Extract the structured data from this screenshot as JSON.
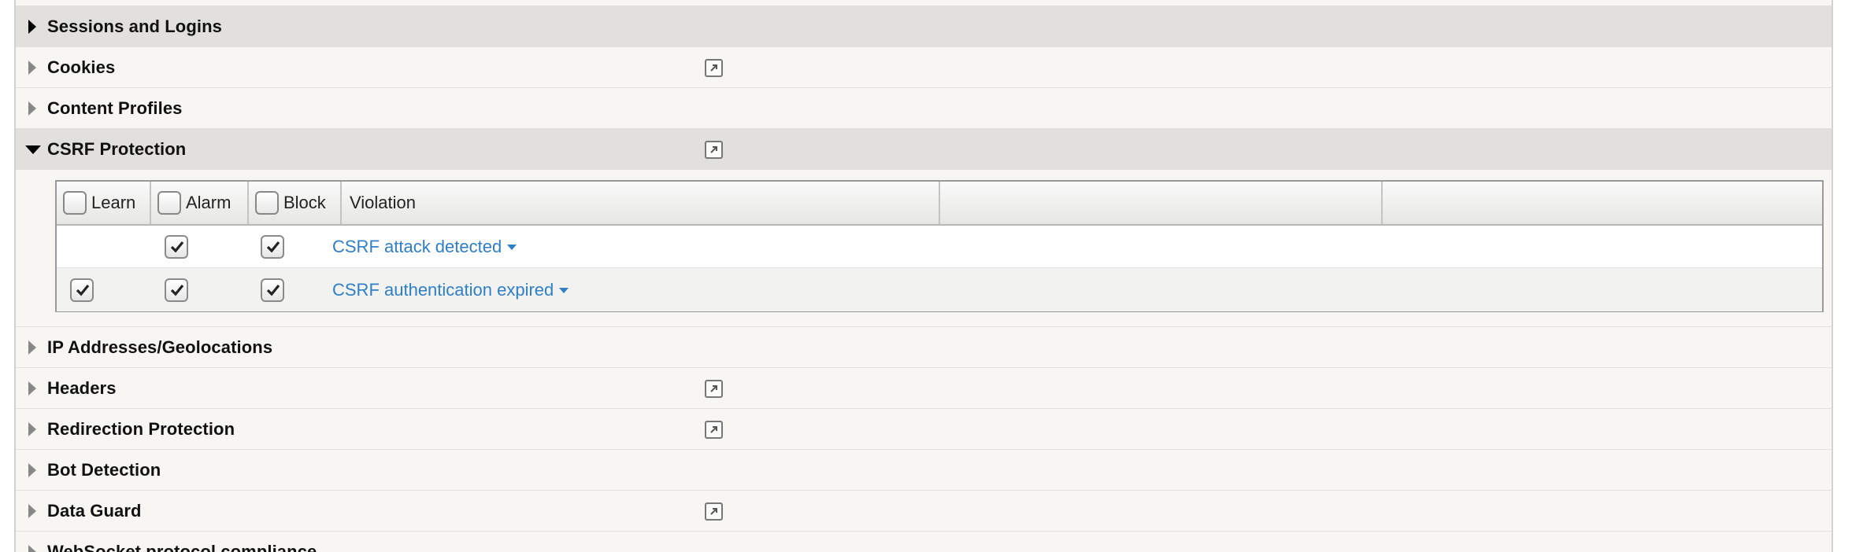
{
  "sections": [
    {
      "label": "Sessions and Logins",
      "state": "collapsed",
      "style": "dark",
      "has_link_icon": false
    },
    {
      "label": "Cookies",
      "state": "collapsed",
      "style": "light",
      "has_link_icon": true
    },
    {
      "label": "Content Profiles",
      "state": "collapsed",
      "style": "light",
      "has_link_icon": false
    },
    {
      "label": "CSRF Protection",
      "state": "expanded",
      "style": "dark",
      "has_link_icon": true
    },
    {
      "label": "IP Addresses/Geolocations",
      "state": "collapsed",
      "style": "light",
      "has_link_icon": false
    },
    {
      "label": "Headers",
      "state": "collapsed",
      "style": "light",
      "has_link_icon": true
    },
    {
      "label": "Redirection Protection",
      "state": "collapsed",
      "style": "light",
      "has_link_icon": true
    },
    {
      "label": "Bot Detection",
      "state": "collapsed",
      "style": "light",
      "has_link_icon": false
    },
    {
      "label": "Data Guard",
      "state": "collapsed",
      "style": "light",
      "has_link_icon": true
    },
    {
      "label": "WebSocket protocol compliance",
      "state": "collapsed",
      "style": "light",
      "has_link_icon": false
    }
  ],
  "violations_table": {
    "headers": {
      "learn": "Learn",
      "alarm": "Alarm",
      "block": "Block",
      "violation": "Violation"
    },
    "rows": [
      {
        "learn": false,
        "alarm": true,
        "block": true,
        "violation": "CSRF attack detected"
      },
      {
        "learn": true,
        "alarm": true,
        "block": true,
        "violation": "CSRF authentication expired"
      }
    ]
  },
  "colors": {
    "link": "#2e7fc5",
    "section_dark": "#e1e0dc",
    "section_light": "#f7f6f3"
  },
  "icons": {
    "collapsed": "triangle-right-icon",
    "expanded": "triangle-down-icon",
    "link": "external-link-icon"
  }
}
